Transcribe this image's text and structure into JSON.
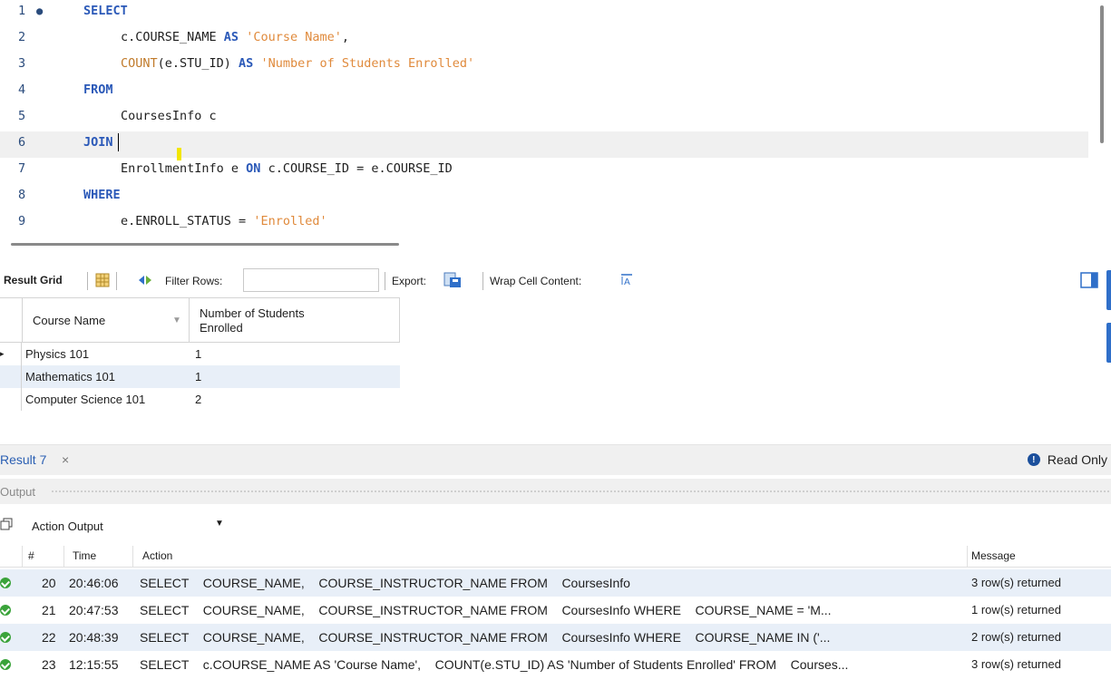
{
  "editor": {
    "lines": [
      {
        "num": "1",
        "parts": [
          {
            "t": "SELECT",
            "c": "kw"
          }
        ]
      },
      {
        "num": "2",
        "parts": [
          {
            "t": "c.COURSE_NAME ",
            "c": "plain"
          },
          {
            "t": "AS",
            "c": "kw"
          },
          {
            "t": " 'Course Name'",
            "c": "str"
          },
          {
            "t": ",",
            "c": "plain"
          }
        ]
      },
      {
        "num": "3",
        "parts": [
          {
            "t": "COUNT",
            "c": "fn"
          },
          {
            "t": "(e.STU_ID) ",
            "c": "plain"
          },
          {
            "t": "AS",
            "c": "kw"
          },
          {
            "t": " 'Number of Students Enrolled'",
            "c": "str"
          }
        ]
      },
      {
        "num": "4",
        "parts": [
          {
            "t": "FROM",
            "c": "kw"
          }
        ]
      },
      {
        "num": "5",
        "parts": [
          {
            "t": "CoursesInfo c",
            "c": "plain"
          }
        ]
      },
      {
        "num": "6",
        "parts": [
          {
            "t": "JOIN",
            "c": "kw"
          }
        ]
      },
      {
        "num": "7",
        "parts": [
          {
            "t": "EnrollmentInfo e ",
            "c": "plain"
          },
          {
            "t": "ON",
            "c": "kw"
          },
          {
            "t": " c.COURSE_ID = e.COURSE_ID",
            "c": "plain"
          }
        ]
      },
      {
        "num": "8",
        "parts": [
          {
            "t": "WHERE",
            "c": "kw"
          }
        ]
      },
      {
        "num": "9",
        "parts": [
          {
            "t": "e.ENROLL_STATUS = ",
            "c": "plain"
          },
          {
            "t": "'Enrolled'",
            "c": "str"
          }
        ]
      }
    ],
    "breakpoint_symbol": "●"
  },
  "result_toolbar": {
    "result_grid_label": "Result Grid",
    "filter_rows_label": "Filter Rows:",
    "filter_value": "",
    "export_label": "Export:",
    "wrap_label": "Wrap Cell Content:"
  },
  "grid": {
    "columns": [
      "Course Name",
      "Number of Students Enrolled"
    ],
    "rows": [
      [
        "Physics 101",
        "1"
      ],
      [
        "Mathematics 101",
        "1"
      ],
      [
        "Computer Science 101",
        "2"
      ]
    ]
  },
  "result_tab": {
    "label": "Result 7",
    "close": "×",
    "read_only": "Read Only"
  },
  "output": {
    "label": "Output",
    "selector": "Action Output",
    "columns": [
      "#",
      "Time",
      "Action",
      "Message"
    ],
    "rows": [
      {
        "num": "20",
        "time": "20:46:06",
        "action": "SELECT    COURSE_NAME,    COURSE_INSTRUCTOR_NAME FROM    CoursesInfo",
        "message": "3 row(s) returned"
      },
      {
        "num": "21",
        "time": "20:47:53",
        "action": "SELECT    COURSE_NAME,    COURSE_INSTRUCTOR_NAME FROM    CoursesInfo WHERE    COURSE_NAME = 'M...",
        "message": "1 row(s) returned"
      },
      {
        "num": "22",
        "time": "20:48:39",
        "action": "SELECT    COURSE_NAME,    COURSE_INSTRUCTOR_NAME FROM    CoursesInfo WHERE    COURSE_NAME IN ('...",
        "message": "2 row(s) returned"
      },
      {
        "num": "23",
        "time": "12:15:55",
        "action": "SELECT    c.COURSE_NAME AS 'Course Name',    COUNT(e.STU_ID) AS 'Number of Students Enrolled' FROM    Courses...",
        "message": "3 row(s) returned"
      }
    ]
  }
}
